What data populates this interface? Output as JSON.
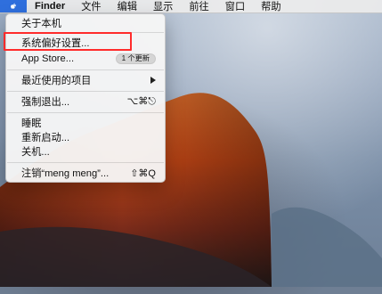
{
  "menubar": {
    "apple_icon": "apple-logo-icon",
    "items": [
      "Finder",
      "文件",
      "编辑",
      "显示",
      "前往",
      "窗口",
      "帮助"
    ]
  },
  "apple_menu": {
    "items": [
      {
        "label": "关于本机"
      },
      {
        "label": "系统偏好设置..."
      },
      {
        "label": "App Store...",
        "badge": "1 个更新"
      },
      {
        "label": "最近使用的项目",
        "submenu": true
      },
      {
        "label": "强制退出...",
        "shortcut": "⌥⌘⎋"
      },
      {
        "label": "睡眠"
      },
      {
        "label": "重新启动..."
      },
      {
        "label": "关机..."
      },
      {
        "label": "注销“meng meng”...",
        "shortcut": "⇧⌘Q"
      }
    ]
  },
  "colors": {
    "menubar_bg": "#ebebeb",
    "apple_highlight": "#2f6fdd",
    "highlight_box": "#ff2b2b"
  }
}
